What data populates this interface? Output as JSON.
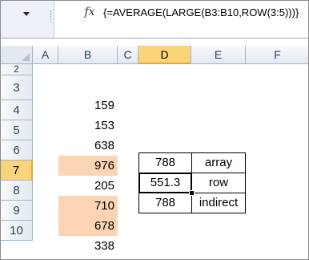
{
  "formula_bar": {
    "name_box_value": "",
    "fx_label": "fx",
    "formula": "{=AVERAGE(LARGE(B3:B10,ROW(3:5)))}"
  },
  "columns": [
    "A",
    "B",
    "C",
    "D",
    "E",
    "F"
  ],
  "selected_column": "D",
  "rows": [
    "2",
    "3",
    "4",
    "5",
    "6",
    "7",
    "8",
    "9",
    "10"
  ],
  "selected_row": "7",
  "cells": {
    "B3": "159",
    "B4": "153",
    "B5": "638",
    "B6": "976",
    "B7": "205",
    "B8": "710",
    "B9": "678",
    "B10": "338",
    "D6": "788",
    "E6": "array",
    "D7": "551.3",
    "E7": "row",
    "D8": "788",
    "E8": "indirect"
  },
  "highlight_color": "#fbd4b4",
  "highlighted_cells": [
    "B6",
    "B8",
    "B9"
  ],
  "active_cell": "D7"
}
